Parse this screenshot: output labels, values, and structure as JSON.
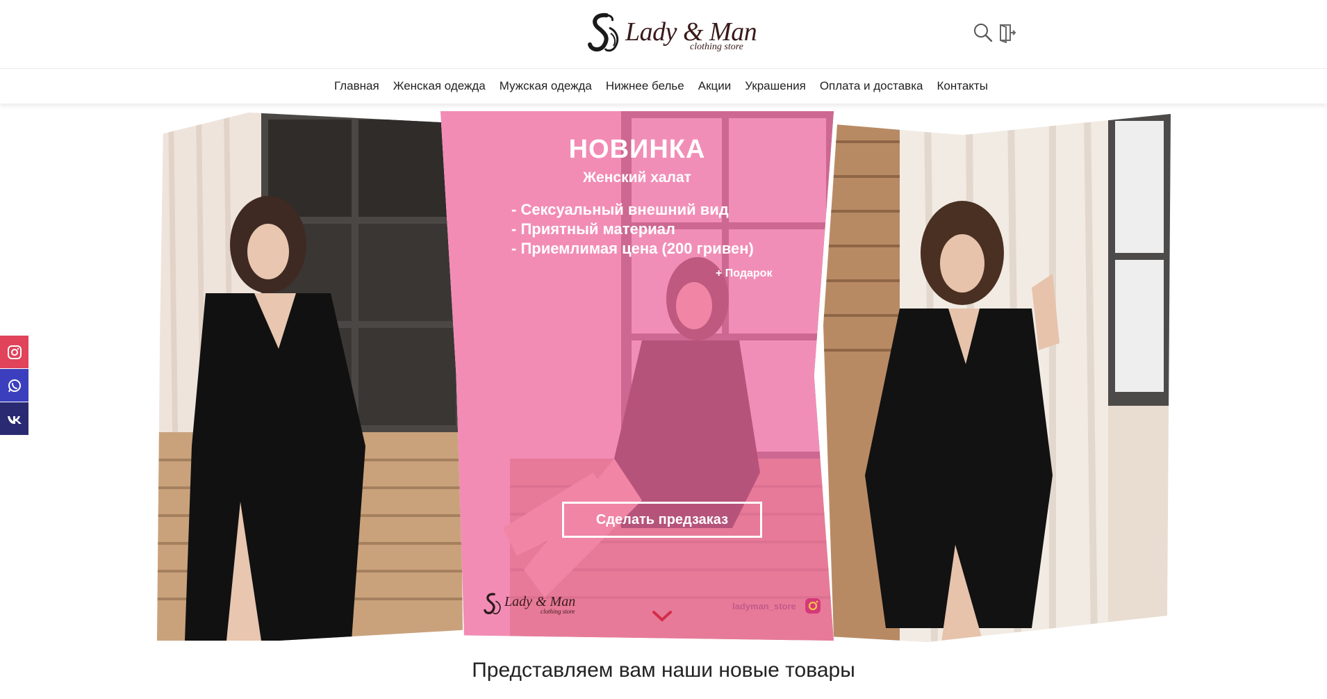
{
  "header": {
    "logo": {
      "name": "Lady & Man",
      "subtitle": "clothing store"
    },
    "icons": {
      "search": "search-icon",
      "login": "login-door-icon"
    }
  },
  "nav": {
    "items": [
      {
        "label": "Главная"
      },
      {
        "label": "Женская одежда"
      },
      {
        "label": "Мужская одежда"
      },
      {
        "label": "Нижнее белье"
      },
      {
        "label": "Акции"
      },
      {
        "label": "Украшения"
      },
      {
        "label": "Оплата и доставка"
      },
      {
        "label": "Контакты"
      }
    ]
  },
  "social": [
    {
      "icon": "instagram-icon",
      "color": "#e0435a"
    },
    {
      "icon": "whatsapp-icon",
      "color": "#3b3fbd"
    },
    {
      "icon": "vk-icon",
      "color": "#2a2a72"
    }
  ],
  "hero": {
    "title": "НОВИНКА",
    "subtitle": "Женский халат",
    "features": [
      "- Сексуальный внешний вид",
      "- Приятный материал",
      "- Приемлимая цена (200 гривен)"
    ],
    "gift": "+ Подарок",
    "cta": "Сделать предзаказ",
    "watermark": {
      "name": "Lady & Man",
      "subtitle": "clothing store"
    },
    "instagram_handle": "ladyman_store",
    "overlay_color": "#f36ca4"
  },
  "section": {
    "title": "Представляем вам наши новые товары"
  }
}
